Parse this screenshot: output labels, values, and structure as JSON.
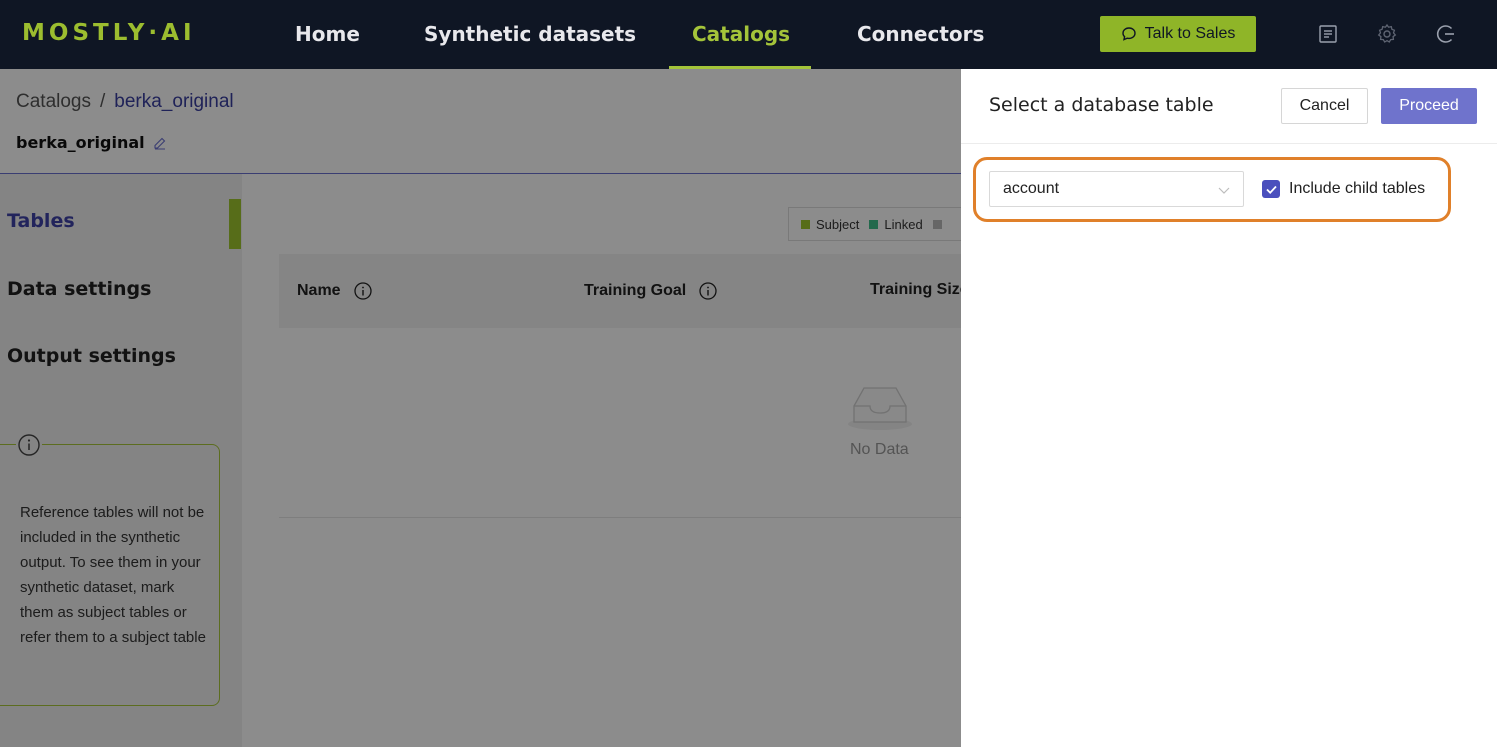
{
  "nav": {
    "logo": "MOSTLY·AI",
    "items": [
      {
        "label": "Home",
        "active": false
      },
      {
        "label": "Synthetic datasets",
        "active": false
      },
      {
        "label": "Catalogs",
        "active": true
      },
      {
        "label": "Connectors",
        "active": false
      }
    ],
    "talk_to_sales": "Talk to Sales",
    "icons": [
      "docs-icon",
      "settings-icon",
      "logout-icon"
    ]
  },
  "breadcrumb": {
    "root": "Catalogs",
    "separator": "/",
    "current": "berka_original"
  },
  "catalog_name": "berka_original",
  "sidebar": {
    "items": [
      {
        "label": "Tables",
        "active": true
      },
      {
        "label": "Data settings",
        "active": false
      },
      {
        "label": "Output settings",
        "active": false
      }
    ],
    "info_text": "Reference tables will not be included in the synthetic output. To see them in your synthetic dataset, mark them as subject tables or refer them to a subject table"
  },
  "legend": [
    {
      "label": "Subject",
      "color": "#9ec72f"
    },
    {
      "label": "Linked",
      "color": "#3fbf8a"
    },
    {
      "label": "",
      "color": "#bbbbbb"
    }
  ],
  "table": {
    "columns": [
      {
        "label": "Name",
        "info": true
      },
      {
        "label": "Training Goal",
        "info": true
      },
      {
        "label": "Training Size",
        "info": false
      }
    ],
    "empty_text": "No Data"
  },
  "drawer": {
    "title": "Select a database table",
    "cancel_label": "Cancel",
    "proceed_label": "Proceed",
    "table_select_value": "account",
    "include_child_tables_label": "Include child tables",
    "include_child_tables_checked": true
  },
  "colors": {
    "nav_bg": "#0f1624",
    "accent_green": "#a4c43a",
    "primary_purple": "#6f73cc",
    "highlight_orange": "#e0802a"
  }
}
